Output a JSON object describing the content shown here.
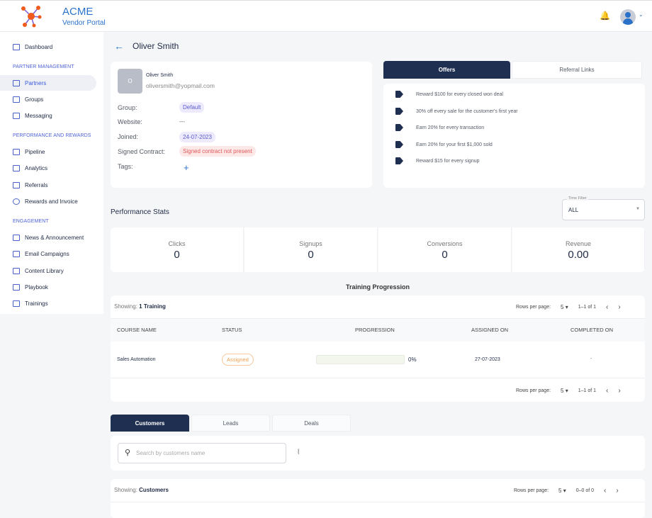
{
  "header": {
    "brand": "ACME",
    "subtitle": "Vendor Portal"
  },
  "sidebar": {
    "dashboard": "Dashboard",
    "sections": [
      "PARTNER MANAGEMENT",
      "PERFORMANCE AND REWARDS",
      "ENGAGEMENT"
    ],
    "items": [
      "Partners",
      "Groups",
      "Messaging",
      "Pipeline",
      "Analytics",
      "Referrals",
      "Rewards and Invoice",
      "News & Announcement",
      "Email Campaigns",
      "Content Library",
      "Playbook",
      "Trainings"
    ]
  },
  "page": {
    "title": "Oliver Smith"
  },
  "profile": {
    "initial": "O",
    "name": "Oliver Smith",
    "email": "oliversmith@yopmail.com",
    "labels": [
      "Group:",
      "Website:",
      "Joined:",
      "Signed Contract:",
      "Tags:"
    ],
    "group": "Default",
    "website": "---",
    "joined": "24-07-2023",
    "contract": "Signed contract not present",
    "add_tag": "+"
  },
  "offers": {
    "tabs": [
      "Offers",
      "Referral Links"
    ],
    "items": [
      "Reward $100 for every closed won deal",
      "30% off every sale for the customer's first year",
      "Earn 20% for every transaction",
      "Earn 20% for your first $1,000 sold",
      "Reward $15 for every signup"
    ]
  },
  "stats": {
    "title": "Performance Stats",
    "filter_label": "Time Filter",
    "filter_value": "ALL",
    "items": [
      {
        "label": "Clicks",
        "value": "0"
      },
      {
        "label": "Signups",
        "value": "0"
      },
      {
        "label": "Conversions",
        "value": "0"
      },
      {
        "label": "Revenue",
        "value": "0.00"
      }
    ]
  },
  "training": {
    "title": "Training Progression",
    "showing": "Showing:",
    "count": "1 Training",
    "rows_label": "Rows per page:",
    "rows": "5",
    "range": "1–1 of 1",
    "columns": [
      "COURSE NAME",
      "STATUS",
      "PROGRESSION",
      "ASSIGNED ON",
      "COMPLETED ON"
    ],
    "row": {
      "course": "Sales Automation",
      "status": "Assigned",
      "progress": 0,
      "progress_text": "0%",
      "assigned": "27-07-2023",
      "completed": "-"
    }
  },
  "bottom": {
    "tabs": [
      "Customers",
      "Leads",
      "Deals"
    ],
    "search_placeholder": "Search by customers name",
    "showing": "Showing:",
    "entity": "Customers",
    "rows_label": "Rows per page:",
    "rows": "5",
    "range": "0–0 of 0"
  }
}
